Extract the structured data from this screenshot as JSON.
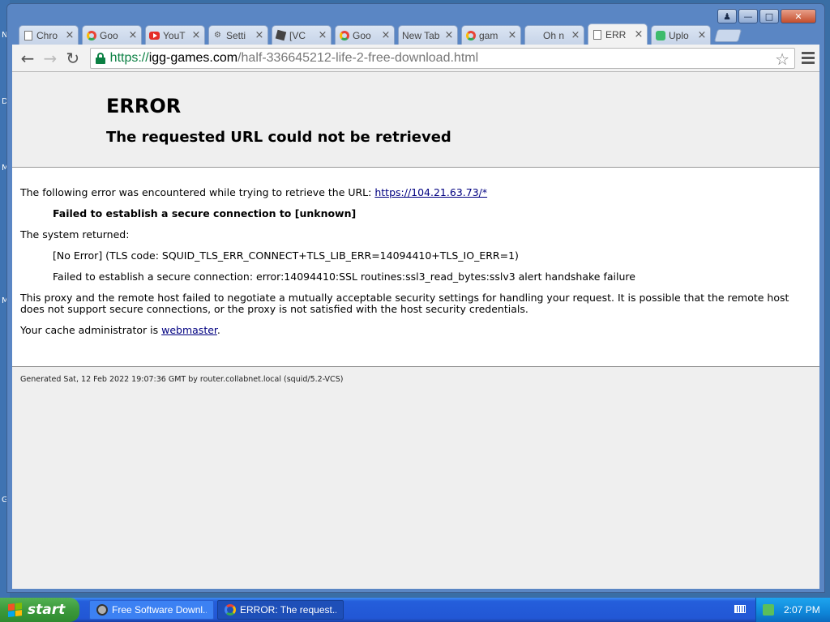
{
  "desktop": {
    "letters": [
      "N",
      "D",
      "M",
      "M",
      "G"
    ]
  },
  "tabs": [
    {
      "label": "Chro",
      "icon": "page-icon",
      "active": false
    },
    {
      "label": "Goo",
      "icon": "google-icon",
      "active": false
    },
    {
      "label": "YouT",
      "icon": "youtube-icon",
      "active": false
    },
    {
      "label": "Setti",
      "icon": "gear-icon",
      "active": false
    },
    {
      "label": "[VC",
      "icon": "roblox-icon",
      "active": false
    },
    {
      "label": "Goo",
      "icon": "google-icon",
      "active": false
    },
    {
      "label": "New Tab",
      "icon": "none",
      "active": false
    },
    {
      "label": "gam",
      "icon": "google-icon",
      "active": false
    },
    {
      "label": "Oh n",
      "icon": "none",
      "active": false
    },
    {
      "label": "ERR",
      "icon": "page-icon",
      "active": true
    },
    {
      "label": "Uplo",
      "icon": "recycle-icon",
      "active": false
    }
  ],
  "toolbar": {
    "url_scheme": "https://",
    "url_host": "igg-games.com",
    "url_path": "/half-336645212-life-2-free-download.html"
  },
  "error_page": {
    "title": "ERROR",
    "subtitle": "The requested URL could not be retrieved",
    "intro": "The following error was encountered while trying to retrieve the URL: ",
    "url_link": "https://104.21.63.73/*",
    "failure": "Failed to establish a secure connection to [unknown]",
    "system_returned": "The system returned:",
    "tls_code": "[No Error] (TLS code: SQUID_TLS_ERR_CONNECT+TLS_LIB_ERR=14094410+TLS_IO_ERR=1)",
    "ssl_detail": "Failed to establish a secure connection: error:14094410:SSL routines:ssl3_read_bytes:sslv3 alert handshake failure",
    "explanation": "This proxy and the remote host failed to negotiate a mutually acceptable security settings for handling your request. It is possible that the remote host does not support secure connections, or the proxy is not satisfied with the host security credentials.",
    "admin_prefix": "Your cache administrator is ",
    "admin_link": "webmaster",
    "admin_suffix": ".",
    "footer": "Generated Sat, 12 Feb 2022 19:07:36 GMT by router.collabnet.local (squid/5.2-VCS)"
  },
  "taskbar": {
    "start_label": "start",
    "items": [
      {
        "label": "Free Software Downl...",
        "active": false
      },
      {
        "label": "ERROR: The request...",
        "active": true
      }
    ],
    "clock": "2:07 PM"
  },
  "colors": {
    "link": "#000080",
    "secure_green": "#0b8043",
    "taskbar_blue": "#245edb"
  }
}
